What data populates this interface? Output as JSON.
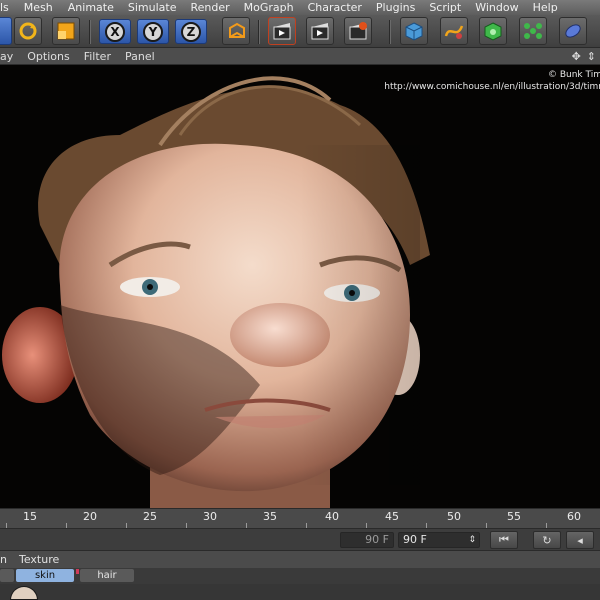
{
  "menubar": {
    "items": [
      "ls",
      "Mesh",
      "Animate",
      "Simulate",
      "Render",
      "MoGraph",
      "Character",
      "Plugins",
      "Script",
      "Window",
      "Help"
    ]
  },
  "toolbar": {
    "icons": [
      "move-tool-icon",
      "rotate-tool-icon",
      "scale-tool-icon",
      "x-axis-lock-icon",
      "y-axis-lock-icon",
      "z-axis-lock-icon",
      "coordinate-system-icon",
      "render-view-icon",
      "render-picture-viewer-icon",
      "render-settings-icon",
      "cube-primitive-icon",
      "spline-pen-icon",
      "nurbs-icon",
      "array-cloner-icon",
      "deformer-icon"
    ],
    "axis_labels": [
      "X",
      "Y",
      "Z"
    ]
  },
  "viewport_menu": {
    "items": [
      "ay",
      "Options",
      "Filter",
      "Panel"
    ],
    "nav_icons": [
      "move-view-icon",
      "zoom-view-icon"
    ]
  },
  "viewport": {
    "credit_line1": "© Bunk Tim",
    "credit_line2": "http://www.comichouse.nl/en/illustration/3d/timr"
  },
  "timeline": {
    "ticks": [
      "15",
      "20",
      "25",
      "30",
      "35",
      "40",
      "45",
      "50",
      "55",
      "60"
    ],
    "end_frame_field": "90 F",
    "end_frame_select": "90 F"
  },
  "material_manager": {
    "menu": [
      "n",
      "Texture"
    ],
    "tabs": [
      {
        "label": "",
        "active": false
      },
      {
        "label": "skin",
        "active": true
      },
      {
        "label": "hair",
        "active": false
      }
    ]
  },
  "colors": {
    "accent_blue": "#3e6fc4",
    "active_tab": "#8fb3e0",
    "menu_bg": "#6b6b6b"
  }
}
